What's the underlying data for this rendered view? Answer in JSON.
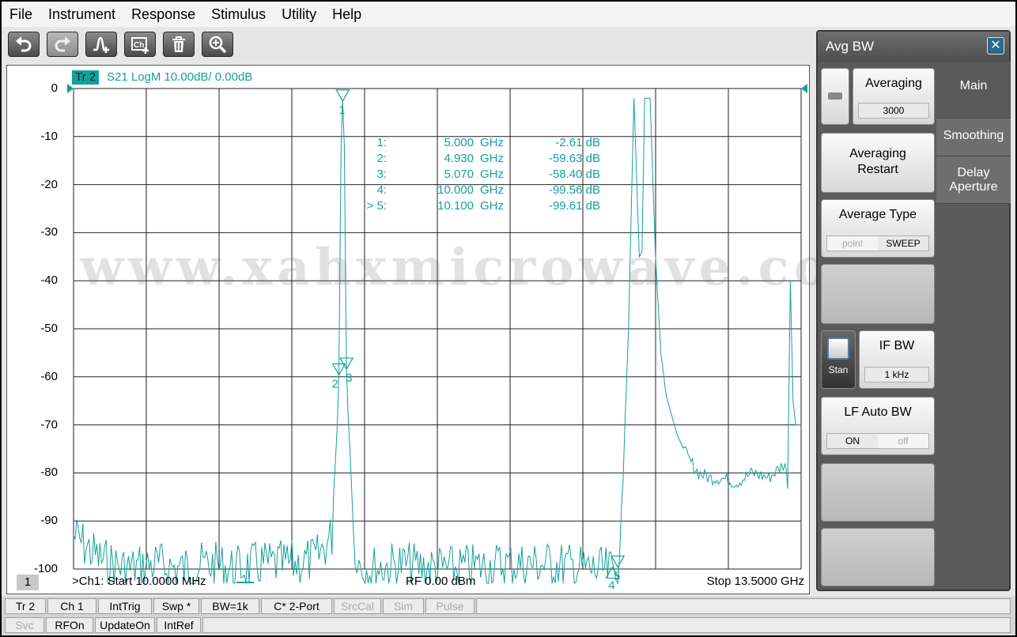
{
  "menu": [
    "File",
    "Instrument",
    "Response",
    "Stimulus",
    "Utility",
    "Help"
  ],
  "toolbar": {
    "buttons": [
      "undo-icon",
      "redo-icon",
      "add-marker-icon",
      "add-channel-icon",
      "delete-icon",
      "zoom-icon"
    ]
  },
  "trace": {
    "tag": "Tr 2",
    "label": "S21 LogM 10.00dB/  0.00dB",
    "color": "#14a09c"
  },
  "watermark": "www.xahxmicrowave.com",
  "markers": [
    {
      "id": "1:",
      "x": "5.000",
      "unit": "GHz",
      "y": "-2.61 dB"
    },
    {
      "id": "2:",
      "x": "4.930",
      "unit": "GHz",
      "y": "-59.63 dB"
    },
    {
      "id": "3:",
      "x": "5.070",
      "unit": "GHz",
      "y": "-58.40 dB"
    },
    {
      "id": "4:",
      "x": "10.000",
      "unit": "GHz",
      "y": "-99.56 dB"
    },
    {
      "id": "> 5:",
      "x": "10.100",
      "unit": "GHz",
      "y": "-99.61 dB"
    }
  ],
  "marker_labels": [
    "1",
    "2",
    "3",
    "4",
    "5"
  ],
  "channel": {
    "number": "1",
    "start": ">Ch1:  Start   10.0000 MHz",
    "power": "RF     0.00 dBm",
    "stop": "Stop  13.5000 GHz"
  },
  "chart_data": {
    "type": "line",
    "title": "S21 LogM 10.00dB/  0.00dB",
    "xlabel": "",
    "ylabel": "",
    "xlim": [
      0.01,
      13.5
    ],
    "ylim": [
      -103,
      3
    ],
    "yticks": [
      0,
      -10,
      -20,
      -30,
      -40,
      -50,
      -60,
      -70,
      -80,
      -90,
      -100
    ],
    "grid": true,
    "series": [
      {
        "name": "Tr 2",
        "x": [
          0.01,
          0.5,
          1.0,
          1.5,
          2.0,
          2.5,
          3.0,
          3.5,
          4.0,
          4.5,
          4.8,
          4.9,
          4.93,
          4.97,
          5.0,
          5.03,
          5.07,
          5.1,
          5.2,
          5.3,
          5.5,
          6.0,
          7.0,
          8.0,
          9.0,
          9.5,
          10.0,
          10.1,
          10.2,
          10.3,
          10.4,
          10.5,
          10.55,
          10.6,
          10.7,
          10.8,
          10.9,
          11.0,
          11.2,
          11.4,
          11.6,
          11.8,
          12.0,
          12.3,
          12.6,
          12.9,
          13.1,
          13.2,
          13.25,
          13.3,
          13.35,
          13.4,
          13.5
        ],
        "y": [
          -92,
          -97,
          -99,
          -98,
          -99,
          -98,
          -99,
          -98,
          -98,
          -97,
          -92,
          -70,
          -59.6,
          -12,
          -2.6,
          -12,
          -58.4,
          -68,
          -92,
          -98,
          -99,
          -98,
          -99,
          -98,
          -98,
          -99,
          -99.6,
          -99.6,
          -80,
          -50,
          -2,
          -35,
          -34,
          -2,
          -2,
          -35,
          -55,
          -64,
          -72,
          -77,
          -80,
          -81,
          -81,
          -82,
          -80,
          -81,
          -79,
          -78,
          -82,
          -40,
          -65,
          -70,
          -70
        ]
      }
    ]
  },
  "panel": {
    "title": "Avg BW",
    "averaging_label": "Averaging",
    "averaging_value": "3000",
    "restart_label": "Averaging\nRestart",
    "avg_type_label": "Average Type",
    "avg_type_options": [
      "point",
      "SWEEP"
    ],
    "if_bw_label": "IF BW",
    "if_bw_value": "1 kHz",
    "stan_label": "Stan",
    "lf_auto_label": "LF Auto BW",
    "lf_auto_options": [
      "ON",
      "off"
    ],
    "tabs": [
      "Main",
      "Smoothing",
      "Delay\nAperture"
    ]
  },
  "status_row1": [
    "Tr 2",
    "Ch 1",
    "IntTrig",
    "Swp *",
    "BW=1k",
    "C* 2-Port",
    "SrcCal",
    "Sim",
    "Pulse"
  ],
  "status_row2": [
    "Svc",
    "RFOn",
    "UpdateOn",
    "IntRef"
  ]
}
